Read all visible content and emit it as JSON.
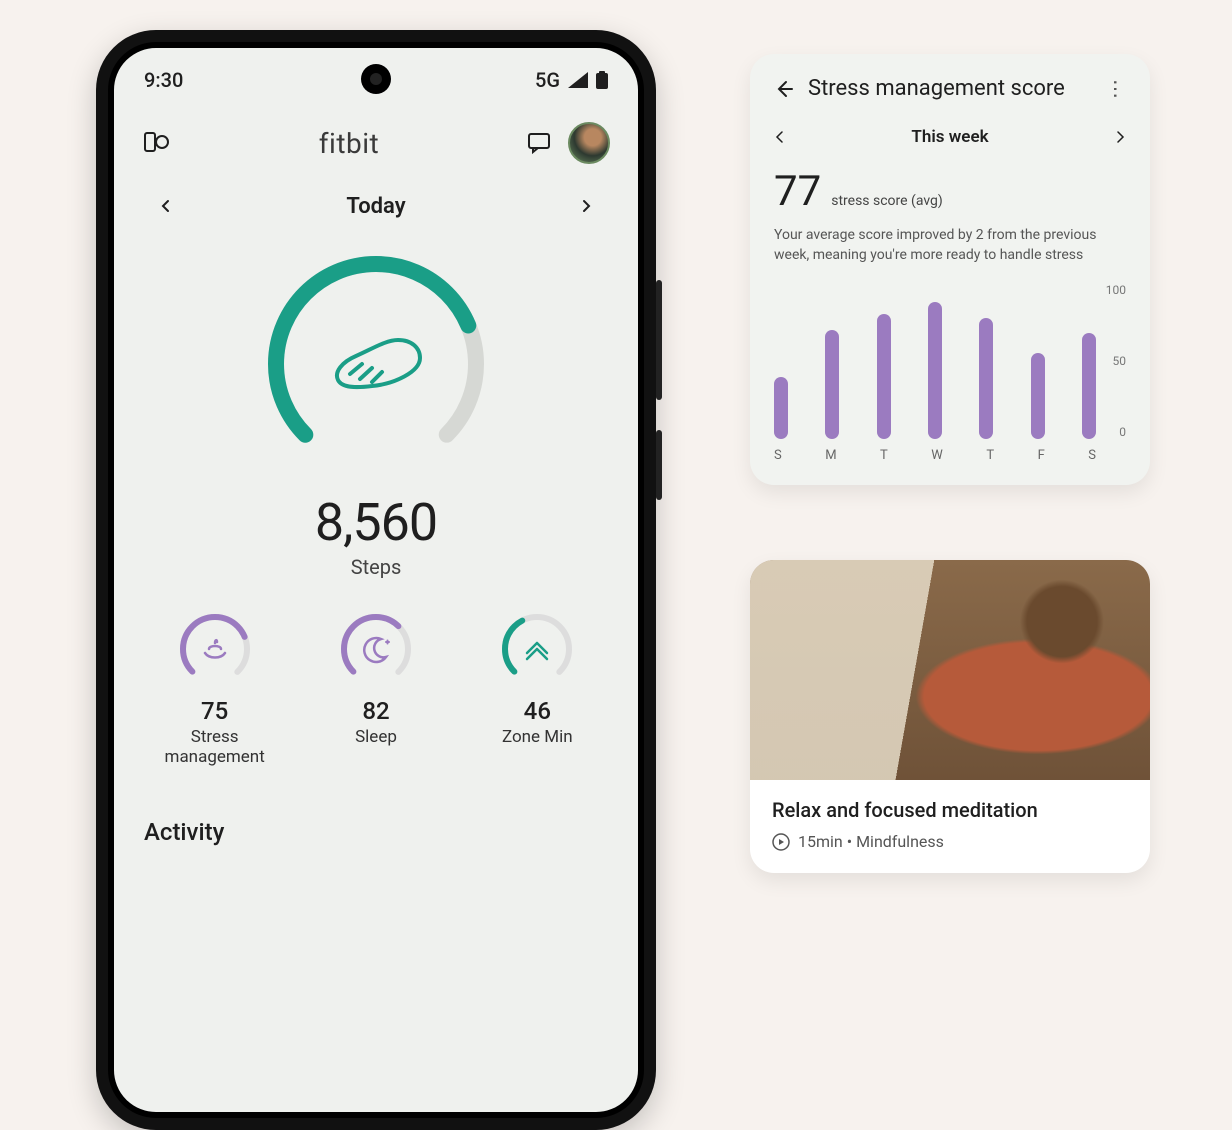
{
  "statusbar": {
    "time": "9:30",
    "network": "5G"
  },
  "header": {
    "brand": "fitbit"
  },
  "dateNav": {
    "label": "Today"
  },
  "steps": {
    "value": "8,560",
    "label": "Steps",
    "progress": 0.75
  },
  "miniStats": [
    {
      "value": "75",
      "label": "Stress management",
      "progress": 0.75,
      "color": "#9b7bc0"
    },
    {
      "value": "82",
      "label": "Sleep",
      "progress": 0.66,
      "color": "#9b7bc0"
    },
    {
      "value": "46",
      "label": "Zone Min",
      "progress": 0.4,
      "color": "#1a9e87"
    }
  ],
  "sections": {
    "activity": "Activity"
  },
  "stressCard": {
    "title": "Stress management score",
    "period": "This week",
    "score": "77",
    "scoreLabel": "stress score (avg)",
    "description": "Your average score improved by 2 from the previous week, meaning you're more ready to handle stress"
  },
  "meditationCard": {
    "title": "Relax and focused meditation",
    "meta": "15min • Mindfulness"
  },
  "chart_data": {
    "type": "bar",
    "categories": [
      "S",
      "M",
      "T",
      "W",
      "T",
      "F",
      "S"
    ],
    "values": [
      40,
      70,
      80,
      88,
      78,
      55,
      68
    ],
    "ylim": [
      0,
      100
    ],
    "yticks": [
      0,
      50,
      100
    ],
    "title": "Stress management score",
    "xlabel": "",
    "ylabel": ""
  }
}
